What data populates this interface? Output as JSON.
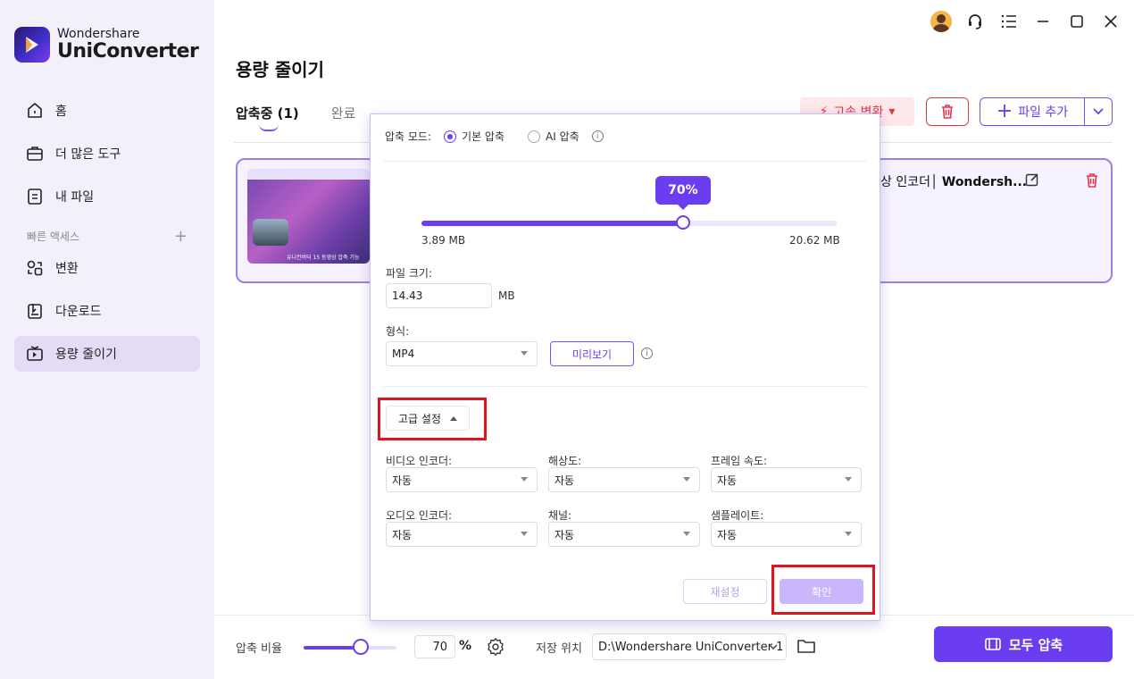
{
  "app": {
    "brand_top": "Wondershare",
    "brand_bottom": "UniConverter"
  },
  "sidebar": {
    "items": [
      {
        "label": "홈",
        "icon": "home-icon"
      },
      {
        "label": "더 많은 도구",
        "icon": "toolbox-icon"
      },
      {
        "label": "내 파일",
        "icon": "file-icon"
      }
    ],
    "section_label": "빠른 액세스",
    "quick": [
      {
        "label": "변환",
        "icon": "convert-icon"
      },
      {
        "label": "다운로드",
        "icon": "download-icon"
      },
      {
        "label": "용량 줄이기",
        "icon": "compress-icon",
        "active": true
      }
    ]
  },
  "main": {
    "title": "용량 줄이기",
    "tabs": [
      {
        "label": "압축중 (1)",
        "active": true
      },
      {
        "label": "완료",
        "active": false
      }
    ],
    "speed_label": "고속 변환",
    "add_file_label": "파일 추가",
    "card": {
      "title_prefix": "상 인코더",
      "title_name": "Wondersh...",
      "thumb_caption": "유니컨버터 15 동영상 압축 기능"
    }
  },
  "bottom": {
    "ratio_label": "압축 비율",
    "ratio_value": "70",
    "ratio_fraction": 0.62,
    "percent": "%",
    "save_label": "저장 위치",
    "save_path": "D:\\Wondershare UniConverter 1",
    "compress_all": "모두 압축"
  },
  "popup": {
    "mode_label": "압축 모드:",
    "mode_basic": "기본 압축",
    "mode_ai": "AI 압축",
    "slider_value": "70%",
    "slider_fraction": 0.63,
    "min_size": "3.89 MB",
    "max_size": "20.62 MB",
    "file_size_label": "파일 크기:",
    "file_size_value": "14.43",
    "file_size_unit": "MB",
    "format_label": "형식:",
    "format_value": "MP4",
    "preview_label": "미리보기",
    "advanced_label": "고급 설정",
    "video_encoder_label": "비디오 인코더:",
    "resolution_label": "해상도:",
    "framerate_label": "프레임 속도:",
    "audio_encoder_label": "오디오 인코더:",
    "channel_label": "채널:",
    "samplerate_label": "샘플레이트:",
    "auto": "자동",
    "reset_label": "재설정",
    "ok_label": "확인"
  },
  "colors": {
    "accent": "#6b3df0",
    "danger": "#e5364a",
    "highlight": "#e0141e"
  }
}
